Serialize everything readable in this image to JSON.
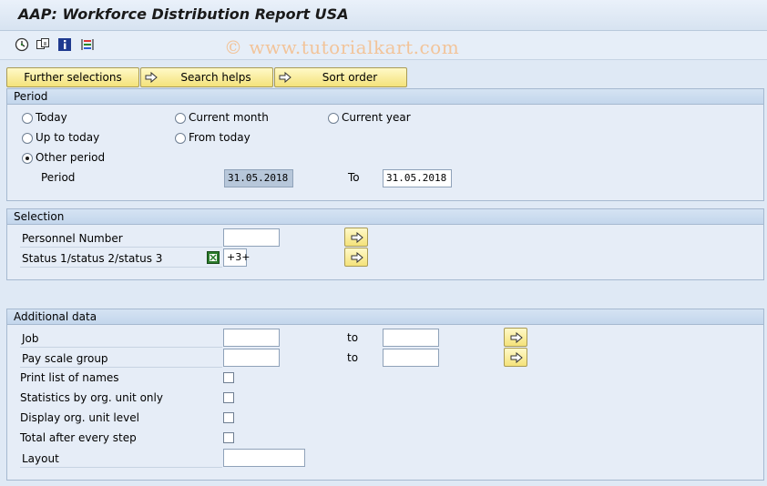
{
  "window": {
    "title": "AAP: Workforce Distribution Report USA"
  },
  "toolbar": {
    "icons": [
      "execute-icon",
      "get-variant-icon",
      "info-icon",
      "selection-options-icon"
    ]
  },
  "watermark": "© www.tutorialkart.com",
  "buttons": {
    "further_selections": "Further selections",
    "search_helps": "Search helps",
    "sort_order": "Sort order"
  },
  "period": {
    "header": "Period",
    "options": {
      "today": "Today",
      "current_month": "Current month",
      "current_year": "Current year",
      "up_to_today": "Up to today",
      "from_today": "From today",
      "other_period": "Other period"
    },
    "selected": "other_period",
    "period_label": "Period",
    "from_value": "31.05.2018",
    "to_label": "To",
    "to_value": "31.05.2018"
  },
  "selection": {
    "header": "Selection",
    "personnel_number_label": "Personnel Number",
    "personnel_number_value": "",
    "status_label": "Status 1/status 2/status 3",
    "status_value": "+3+"
  },
  "additional": {
    "header": "Additional data",
    "job_label": "Job",
    "job_to_label": "to",
    "pay_scale_label": "Pay scale group",
    "pay_scale_to_label": "to",
    "print_list_label": "Print list of names",
    "stats_org_label": "Statistics by org. unit only",
    "display_org_label": "Display org. unit level",
    "total_step_label": "Total after every step",
    "layout_label": "Layout",
    "layout_value": ""
  },
  "colors": {
    "background": "#dfe9f5",
    "button_yellow": "#f4e27a",
    "group_header": "#c3d6ec",
    "watermark": "#f2c49a"
  }
}
